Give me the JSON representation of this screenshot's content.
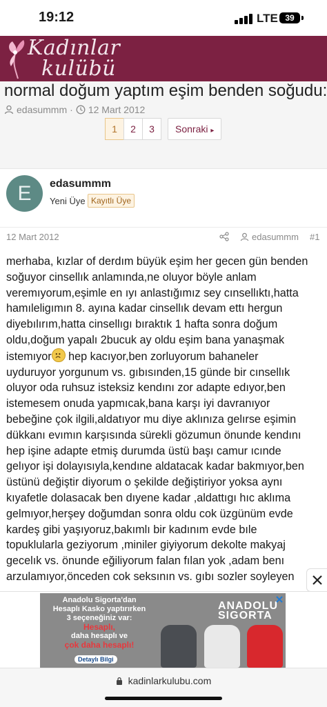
{
  "status_bar": {
    "time": "19:12",
    "network": "LTE",
    "battery": "39"
  },
  "site": {
    "logo_line1": "Kadınlar",
    "logo_line2": "kulübü"
  },
  "thread": {
    "title": "normal doğum yaptım eşim benden soğudu:(",
    "author": "edasummm",
    "date": "12 Mart 2012",
    "separator": "·",
    "pages": [
      "1",
      "2",
      "3"
    ],
    "active_page": "1",
    "next_label": "Sonraki"
  },
  "post": {
    "avatar_letter": "E",
    "username": "edasummm",
    "user_title": "Yeni Üye",
    "badge": "Kayıtlı Üye",
    "date": "12 Mart 2012",
    "author": "edasummm",
    "number": "#1",
    "lines": [
      "merhaba, kızlar of derdım büyük eşim her gecen gün benden",
      "soğuyor cinsellık anlamında,ne oluyor böyle anlam",
      "veremıyorum,eşimle en ıyı anlastığımız sey cınsellıktı,hatta",
      "hamıleligımın 8. ayına kadar cinsellık devam ettı hergun",
      "diyebılırım,hatta cinsellıgı bıraktık 1 hafta sonra doğum",
      "oldu,doğum yapalı 2bucuk ay oldu eşim bana yanaşmak",
      "istemıyor",
      " hep kacıyor,ben zorluyorum bahaneler",
      "uyduruyor yorgunum vs. gıbısınden,15 günde bir cınsellık",
      "oluyor oda ruhsuz isteksiz kendını zor adapte edıyor,ben",
      "istemesem onuda yapmıcak,bana karşı iyi davranıyor",
      "bebeğine çok ilgili,aldatıyor mu diye aklınıza gelırse eşimin",
      "dükkanı evımın karşısında sürekli gözumun önunde kendını",
      "hep işine adapte etmiş durumda üstü başı camur ıcınde",
      "gelıyor işi dolayısıyla,kendıne aldatacak kadar bakmıyor,ben",
      "üstünü değiştir diyorum o şekilde değiştiriyor yoksa aynı",
      "kıyafetle dolasacak ben dıyene kadar ,aldattıgı hıc aklıma",
      "gelmıyor,herşey doğumdan sonra oldu cok üzgünüm evde",
      "kardeş gibi yaşıyoruz,bakımlı bir kadınım evde bıle",
      "topuklularla geziyorum ,miniler giyiyorum dekolte makyaj",
      "gecelık vs. önunde eğiliyorum falan fılan yok ,adam benı",
      "arzulamıyor,önceden cok seksının vs. gıbı sozler soyleyen"
    ]
  },
  "ad": {
    "line1": "Anadolu Sigorta'dan",
    "line2": "Hesaplı Kasko yaptırırken",
    "line3": "3 seçeneğiniz var:",
    "line4": "Hesaplı,",
    "line5": "daha hesaplı ve",
    "line6": "çok daha hesaplı!",
    "button": "Detaylı Bilgi",
    "brand1": "ANADOLU",
    "brand2": "SIGORTA"
  },
  "browser": {
    "url": "kadinlarkulubu.com"
  },
  "colors": {
    "brand": "#7c2142",
    "accent": "#b1742a",
    "avatar": "#5d8a85"
  }
}
